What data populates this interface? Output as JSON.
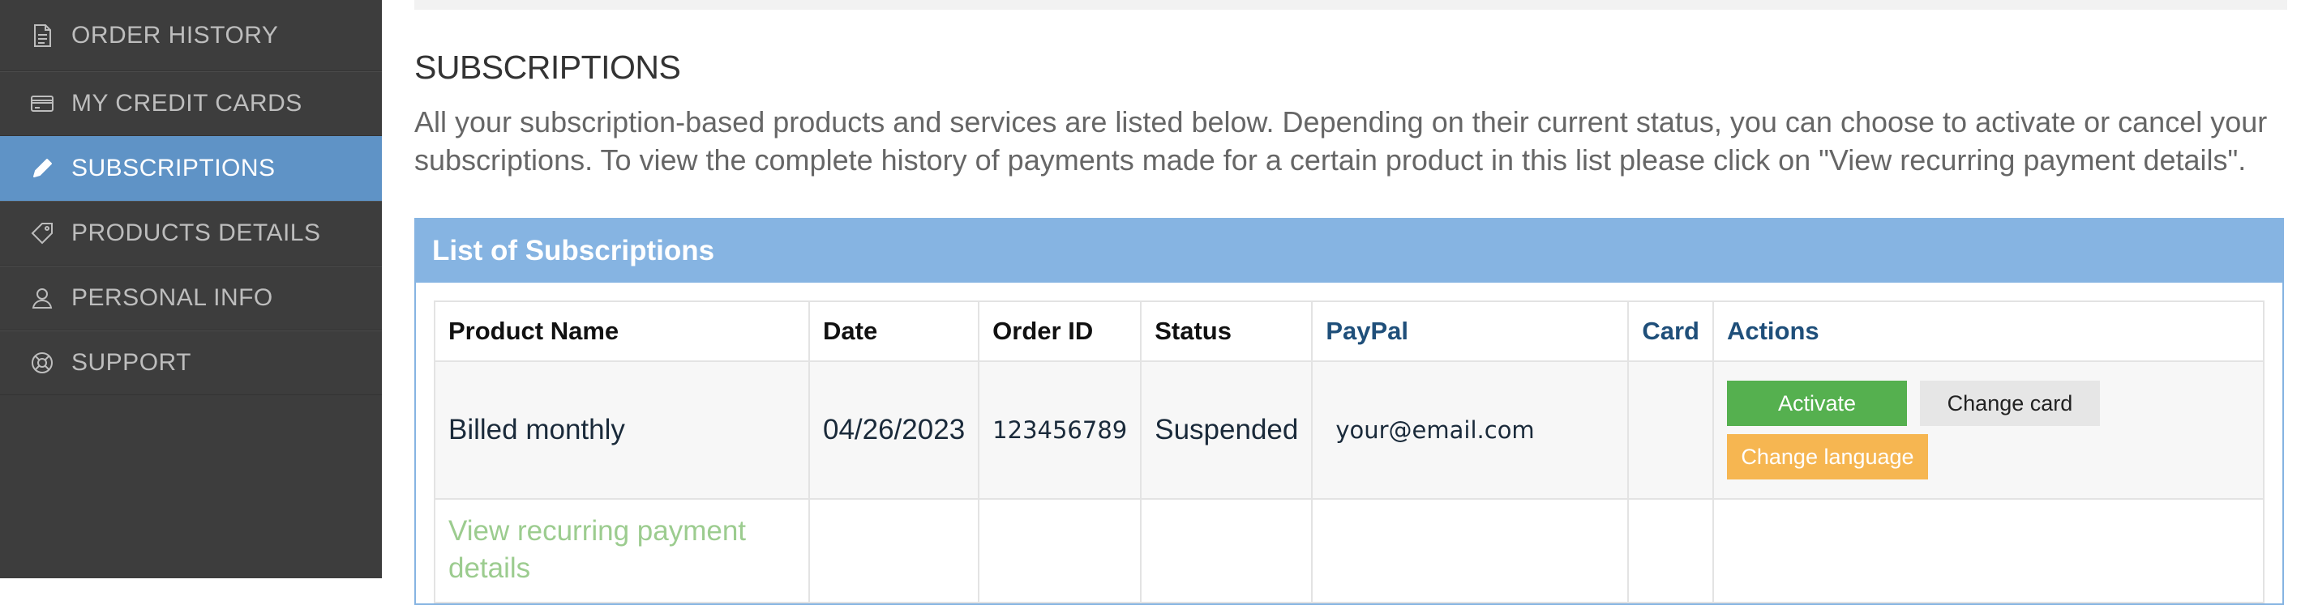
{
  "sidebar": {
    "items": [
      {
        "label": "ORDER HISTORY",
        "icon": "document-icon"
      },
      {
        "label": "MY CREDIT CARDS",
        "icon": "credit-card-icon"
      },
      {
        "label": "SUBSCRIPTIONS",
        "icon": "pencil-icon",
        "active": true
      },
      {
        "label": "PRODUCTS DETAILS",
        "icon": "tag-icon"
      },
      {
        "label": "PERSONAL INFO",
        "icon": "user-icon"
      },
      {
        "label": "SUPPORT",
        "icon": "lifebuoy-icon"
      }
    ]
  },
  "page": {
    "title": "SUBSCRIPTIONS",
    "intro": "All your subscription-based products and services are listed below. Depending on their current status, you can choose to activate or cancel your subscriptions. To view the complete history of payments made for a certain product in this list please click on \"View recurring payment details\"."
  },
  "panel": {
    "title": "List of Subscriptions",
    "columns": [
      "Product Name",
      "Date",
      "Order ID",
      "Status",
      "PayPal",
      "Card",
      "Actions"
    ],
    "row": {
      "product": "Billed monthly",
      "date": "04/26/2023",
      "order_id": "123456789",
      "status": "Suspended",
      "paypal": "your@email.com",
      "card": ""
    },
    "actions": {
      "activate": "Activate",
      "change_card": "Change card",
      "change_language": "Change language"
    },
    "details_link": "View recurring payment details"
  },
  "colors": {
    "sidebar_bg": "#3d3d3d",
    "active": "#5f93c6",
    "panel_header": "#86b4e2",
    "activate": "#55b04f",
    "change_language": "#f6b651",
    "link_green": "#9ccc8f"
  }
}
